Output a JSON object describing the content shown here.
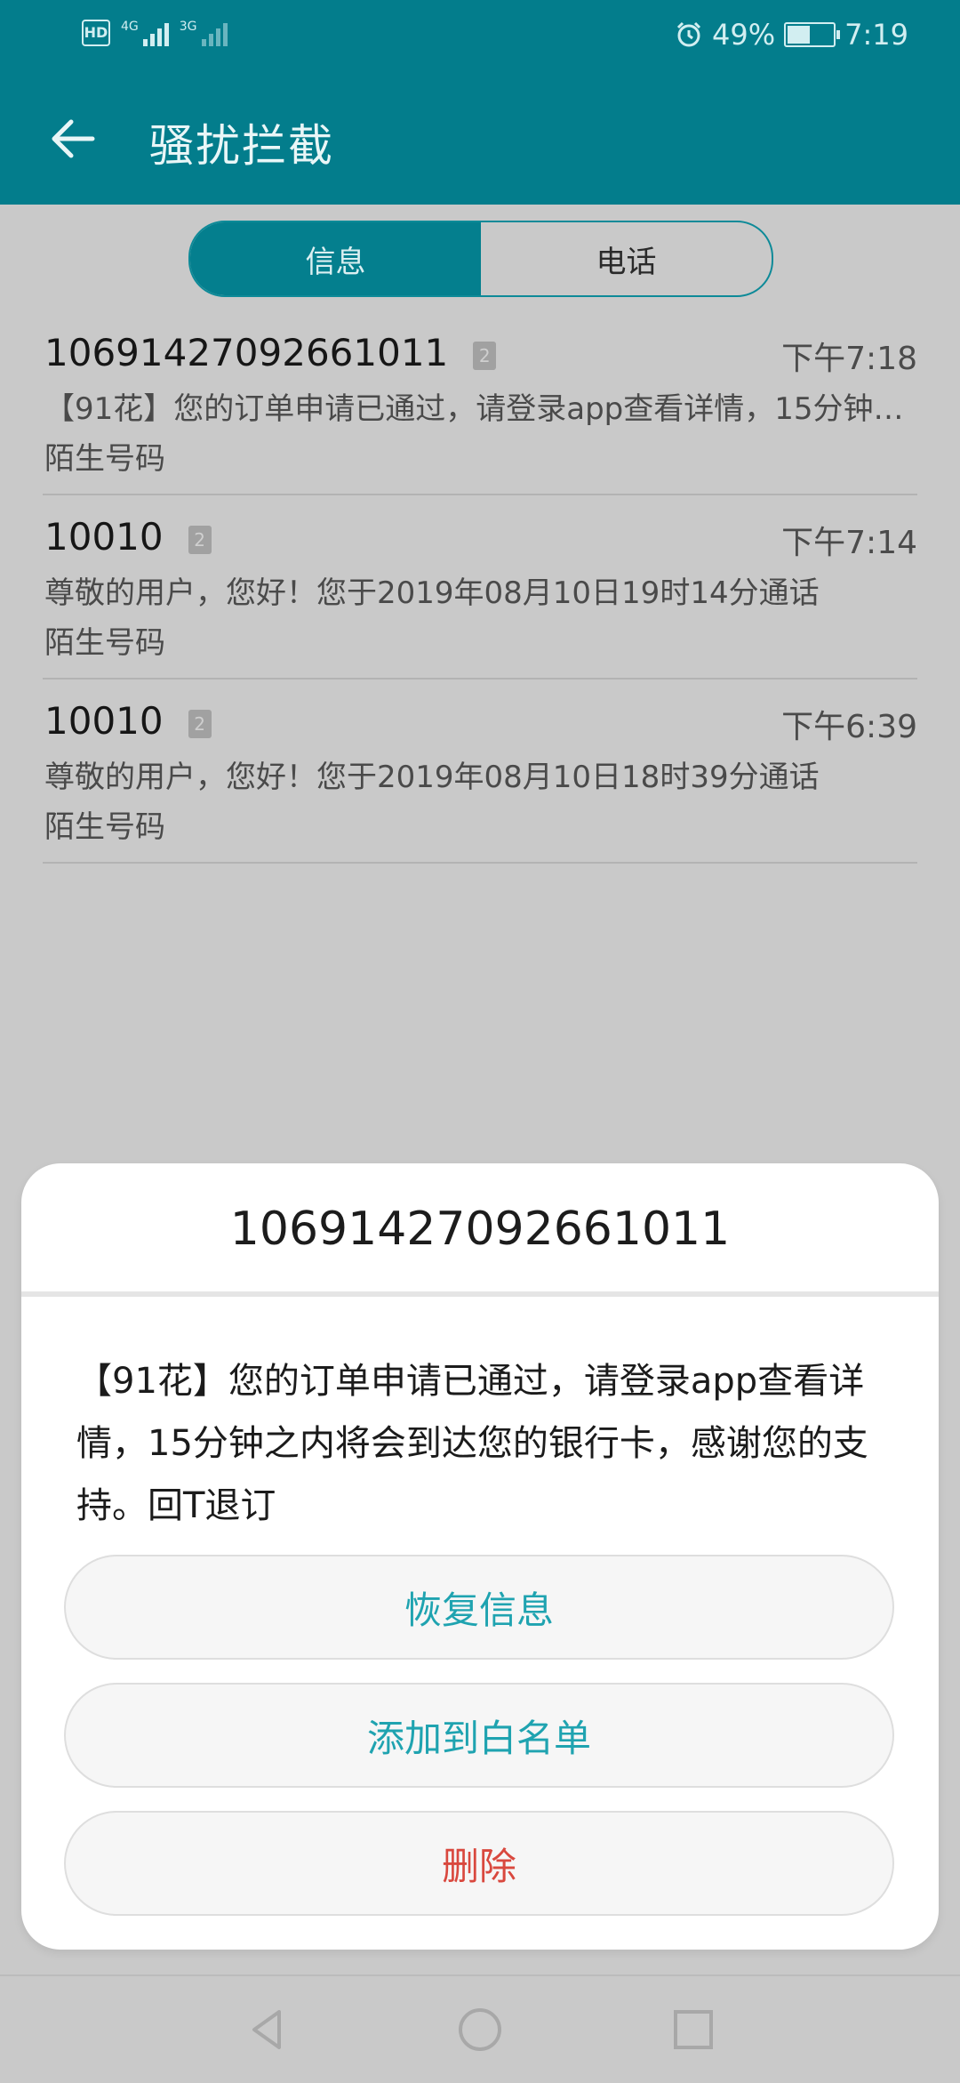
{
  "status_bar": {
    "hd_badge": "HD",
    "sim1_network": "4G",
    "sim2_network": "3G",
    "alarm_icon": "alarm-icon",
    "battery_percent": "49%",
    "battery_level": 0.49,
    "time": "7:19"
  },
  "app_bar": {
    "back_icon": "arrow-left-icon",
    "title": "骚扰拦截",
    "background": "#037d8c"
  },
  "tabs": [
    {
      "label": "信息",
      "selected": true
    },
    {
      "label": "电话",
      "selected": false
    }
  ],
  "messages": [
    {
      "sender": "10691427092661011",
      "sim": "2",
      "time": "下午7:18",
      "preview": "【91花】您的订单申请已通过，请登录app查看详情，15分钟之内将会到达您的银行卡，感谢您的支持。回T退订",
      "label": "陌生号码"
    },
    {
      "sender": "10010",
      "sim": "2",
      "time": "下午7:14",
      "preview": "尊敬的用户，您好！您于2019年08月10日19时14分通话",
      "label": "陌生号码"
    },
    {
      "sender": "10010",
      "sim": "2",
      "time": "下午6:39",
      "preview": "尊敬的用户，您好！您于2019年08月10日18时39分通话",
      "label": "陌生号码"
    }
  ],
  "dialog": {
    "title": "10691427092661011",
    "body": "【91花】您的订单申请已通过，请登录app查看详情，15分钟之内将会到达您的银行卡，感谢您的支持。回T退订",
    "buttons": {
      "restore": "恢复信息",
      "whitelist": "添加到白名单",
      "delete": "删除"
    },
    "accent_color": "#1fa3b0",
    "delete_color": "#d9483e"
  },
  "nav_bar": {
    "back": "triangle-back-icon",
    "home": "circle-home-icon",
    "recents": "square-recents-icon"
  }
}
